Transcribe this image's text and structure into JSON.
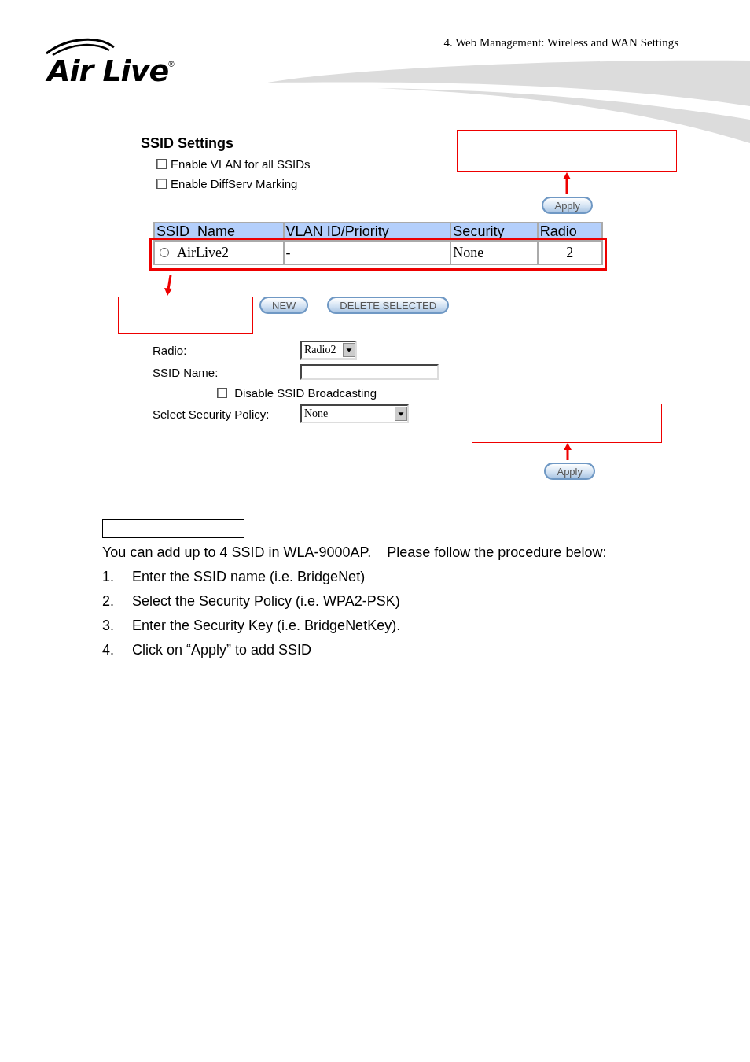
{
  "header": {
    "logo": "Air Live",
    "logo_mark": "®",
    "chapter": "4. Web Management: Wireless and WAN Settings"
  },
  "ssid_settings": {
    "title": "SSID Settings",
    "options": [
      {
        "label": "Enable VLAN for all SSIDs",
        "checked": false
      },
      {
        "label": "Enable DiffServ Marking",
        "checked": false
      }
    ],
    "apply": "Apply",
    "table": {
      "columns": [
        "SSID  Name",
        "VLAN ID/Priority",
        "Security",
        "Radio"
      ],
      "rows": [
        {
          "selected": false,
          "cells": [
            "AirLive2",
            "-",
            "None",
            "2"
          ]
        }
      ]
    },
    "buttons": [
      "NEW",
      "DELETE SELECTED"
    ]
  },
  "form": {
    "fields": [
      {
        "kind": "select",
        "label": "Radio:",
        "value": "Radio2"
      },
      {
        "kind": "input",
        "label": "SSID Name:"
      },
      {
        "kind": "checkbox",
        "label": "Disable SSID Broadcasting",
        "checked": false
      },
      {
        "kind": "select",
        "label": "Select Security Policy:",
        "value": "None"
      }
    ],
    "apply": "Apply"
  },
  "body": {
    "intro": "You can add up to 4 SSID in WLA-9000AP.    Please follow the procedure below:",
    "steps": [
      {
        "number": "1.",
        "text": "Enter the SSID name (i.e. BridgeNet)"
      },
      {
        "number": "2.",
        "text": "Select the Security Policy (i.e. WPA2-PSK)"
      },
      {
        "number": "3.",
        "text": "Enter the Security Key (i.e. BridgeNetKey)."
      },
      {
        "number": "4.",
        "text": "Click on “Apply” to add SSID"
      }
    ]
  }
}
